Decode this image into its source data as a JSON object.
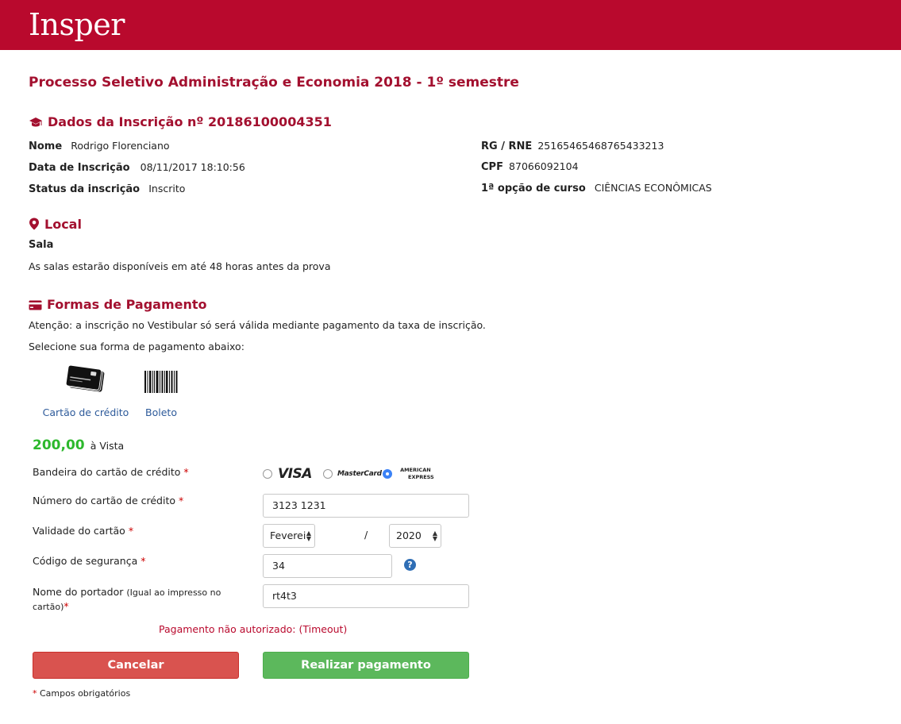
{
  "header": {
    "logo": "Insper"
  },
  "page_title": "Processo Seletivo Administração e Economia 2018 - 1º semestre",
  "inscricao": {
    "title": "Dados da Inscrição nº 20186100004351",
    "icon": "graduation-cap-icon",
    "nome_label": "Nome",
    "nome_value": "Rodrigo Florenciano",
    "data_label": "Data de Inscrição",
    "data_value": "08/11/2017 18:10:56",
    "status_label": "Status da inscrição",
    "status_value": "Inscrito",
    "rg_label": "RG / RNE",
    "rg_value": "25165465468765433213",
    "cpf_label": "CPF",
    "cpf_value": "87066092104",
    "curso_label": "1ª opção de curso",
    "curso_value": "CIÊNCIAS ECONÔMICAS"
  },
  "local": {
    "title": "Local",
    "icon": "map-marker-icon",
    "sala_label": "Sala",
    "sala_text": "As salas estarão disponíveis em até 48 horas antes da prova"
  },
  "pagamento": {
    "title": "Formas de Pagamento",
    "icon": "credit-card-icon",
    "atencao": "Atenção: a inscrição no Vestibular só será válida mediante pagamento da taxa de inscrição.",
    "selecione": "Selecione sua forma de pagamento abaixo:",
    "options": [
      {
        "label": "Cartão de crédito",
        "icon": "credit-cards-icon"
      },
      {
        "label": "Boleto",
        "icon": "barcode-icon"
      }
    ],
    "price": "200,00",
    "price_suffix": "à Vista"
  },
  "form": {
    "bandeira_label": "Bandeira do cartão de crédito",
    "brands": [
      {
        "name": "VISA",
        "selected": false
      },
      {
        "name": "MasterCard",
        "selected": false
      },
      {
        "name_line1": "AMERICAN",
        "name_line2": "EXPRESS",
        "selected": true
      }
    ],
    "numero_label": "Número do cartão de crédito",
    "numero_value": "3123 1231",
    "validade_label": "Validade do cartão",
    "validade_month": "Feverei",
    "validade_sep": "/",
    "validade_year": "2020",
    "codigo_label": "Código de segurança",
    "codigo_value": "34",
    "portador_label": "Nome do portador",
    "portador_note": "(Igual ao impresso no cartão)",
    "portador_value": "rt4t3",
    "required_mark": "*"
  },
  "error_message": "Pagamento não autorizado: (Timeout)",
  "buttons": {
    "cancel": "Cancelar",
    "pay": "Realizar pagamento"
  },
  "footnote": "* Campos obrigatórios",
  "colors": {
    "brand": "#b9092d",
    "title": "#a3102f",
    "price": "#2db82d",
    "link": "#2d5a9a",
    "cancel": "#d9534f",
    "pay": "#5cb85c"
  }
}
